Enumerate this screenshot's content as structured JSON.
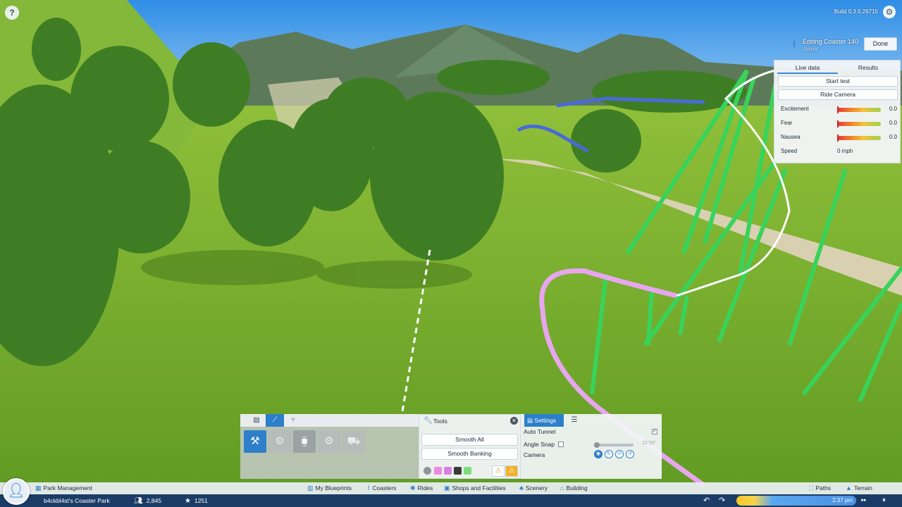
{
  "build": "Build 0.3.5.26715",
  "help_icon": "?",
  "editor": {
    "title": "Editing Coaster 140",
    "subtitle": "Junior",
    "done_label": "Done",
    "tabs": [
      {
        "label": "Live data",
        "active": true
      },
      {
        "label": "Results",
        "active": false
      }
    ],
    "start_test_label": "Start test",
    "ride_camera_label": "Ride Camera",
    "stats": [
      {
        "label": "Excitement",
        "value": "0.0"
      },
      {
        "label": "Fear",
        "value": "0.0"
      },
      {
        "label": "Nausea",
        "value": "0.0"
      }
    ],
    "speed": {
      "label": "Speed",
      "value": "0 mph"
    }
  },
  "track_panel": {
    "tabs": [
      "track-icon",
      "track-piece-icon",
      "track-split-icon"
    ],
    "pieces": [
      "straight-piece-icon",
      "lift-piece-icon",
      "brake-piece-icon",
      "booster-piece-icon",
      "station-piece-icon"
    ]
  },
  "tools": {
    "title": "Tools",
    "smooth_all_label": "Smooth All",
    "smooth_banking_label": "Smooth Banking",
    "colors": [
      "#e98be0",
      "#d97fe0",
      "#3a3a3a",
      "#7be07b"
    ]
  },
  "settings": {
    "tab_label": "Settings",
    "auto_tunnel_label": "Auto Tunnel",
    "auto_tunnel_checked": true,
    "angle_snap_label": "Angle Snap",
    "angle_snap_checked": false,
    "angle_snap_value": "22.50°",
    "camera_label": "Camera"
  },
  "main_bar": {
    "park_management": "Park Management",
    "my_blueprints": "My Blueprints",
    "coasters": "Coasters",
    "rides": "Rides",
    "shops": "Shops and Facilities",
    "scenery": "Scenery",
    "building": "Building",
    "paths": "Paths",
    "terrain": "Terrain"
  },
  "status": {
    "park_name": "b4ckbl4st's Coaster Park",
    "guests": "2,845",
    "rating": "1251",
    "time": "2:37 pm"
  },
  "colors": {
    "accent": "#2d7fc9",
    "status_bar": "#1b3c66"
  }
}
